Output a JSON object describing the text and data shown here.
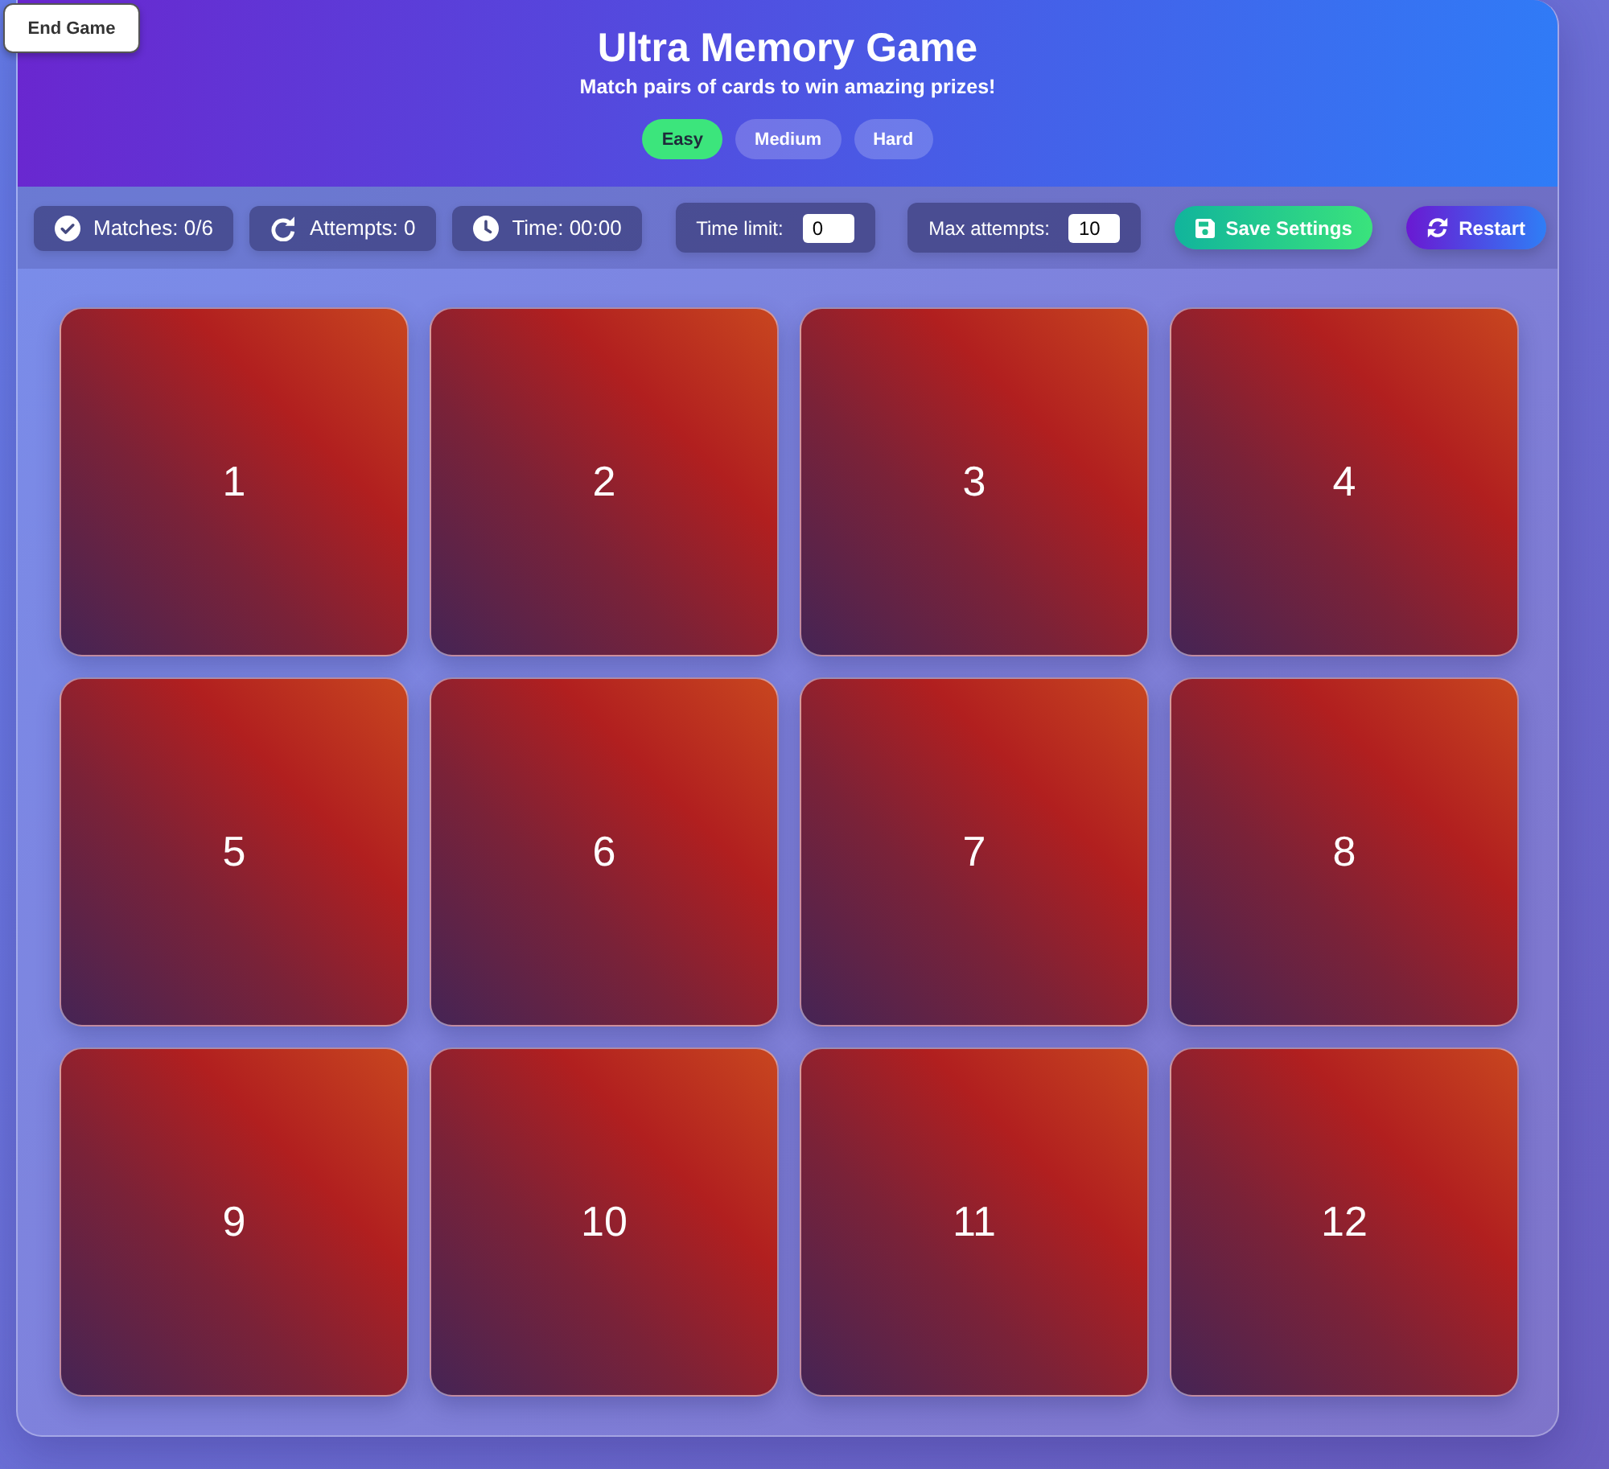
{
  "end_game_button": "End Game",
  "header": {
    "title": "Ultra Memory Game",
    "subtitle": "Match pairs of cards to win amazing prizes!",
    "difficulties": [
      {
        "label": "Easy",
        "selected": true
      },
      {
        "label": "Medium",
        "selected": false
      },
      {
        "label": "Hard",
        "selected": false
      }
    ]
  },
  "toolbar": {
    "stats": [
      {
        "kind": "matches",
        "label": "Matches: 0/6"
      },
      {
        "kind": "attempts",
        "label": "Attempts: 0"
      },
      {
        "kind": "time",
        "label": "Time: 00:00"
      }
    ],
    "settings": [
      {
        "label": "Time limit:",
        "value": "0"
      },
      {
        "label": "Max attempts:",
        "value": "10"
      }
    ],
    "buttons": [
      {
        "kind": "save",
        "label": "Save Settings"
      },
      {
        "kind": "restart",
        "label": "Restart"
      }
    ]
  },
  "cards": [
    "1",
    "2",
    "3",
    "4",
    "5",
    "6",
    "7",
    "8",
    "9",
    "10",
    "11",
    "12"
  ]
}
